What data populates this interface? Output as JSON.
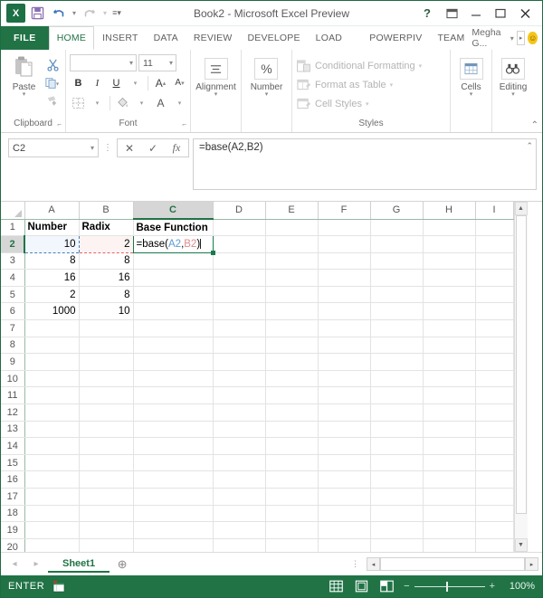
{
  "window": {
    "title": "Book2 - Microsoft Excel Preview",
    "app_icon": "excel-logo-icon",
    "quick_access": [
      {
        "name": "save-icon",
        "glyph": "💾"
      },
      {
        "name": "undo-icon",
        "glyph": "↶"
      },
      {
        "name": "redo-icon",
        "glyph": "↷"
      },
      {
        "name": "customize-qat-icon",
        "glyph": "⌄"
      }
    ],
    "controls": {
      "help": "?",
      "ribbon_display": "❐",
      "minimize": "─",
      "maximize": "☐",
      "close": "✕"
    }
  },
  "tabs": {
    "file": "FILE",
    "items": [
      "HOME",
      "INSERT",
      "DATA",
      "REVIEW",
      "DEVELOPE",
      "LOAD TES",
      "POWERPIV",
      "TEAM"
    ],
    "active": "HOME",
    "user": "Megha G...",
    "user_caret": "▾",
    "signin_arrow": "▸",
    "smiley": "☺"
  },
  "ribbon": {
    "groups": [
      {
        "name": "clipboard",
        "label": "Clipboard",
        "paste_label": "Paste",
        "paste_caret": "▾",
        "side_items": [
          {
            "name": "cut-icon",
            "label": "Cut"
          },
          {
            "name": "copy-icon",
            "label": "Copy"
          },
          {
            "name": "format-painter-icon",
            "label": "Format Painter"
          }
        ],
        "launcher": "⤵"
      },
      {
        "name": "font",
        "label": "Font",
        "font_name": "",
        "font_size": "11",
        "buttons": [
          "B",
          "I",
          "U",
          "▾",
          "A",
          "A",
          "▦",
          "▾",
          "✐",
          "▾",
          "A",
          "▾"
        ],
        "launcher": "⤵"
      },
      {
        "name": "alignment",
        "label": "Alignment",
        "icon": "align-icon",
        "caret": "▾"
      },
      {
        "name": "number",
        "label": "Number",
        "icon": "percent-icon",
        "glyph": "%",
        "caret": "▾"
      },
      {
        "name": "styles",
        "label": "Styles",
        "items": [
          {
            "name": "conditional-formatting",
            "label": "Conditional Formatting",
            "caret": "▾"
          },
          {
            "name": "format-as-table",
            "label": "Format as Table",
            "caret": "▾"
          },
          {
            "name": "cell-styles",
            "label": "Cell Styles",
            "caret": "▾"
          }
        ]
      },
      {
        "name": "cells",
        "label": "Cells",
        "icon": "cells-icon",
        "caret": "▾"
      },
      {
        "name": "editing",
        "label": "Editing",
        "icon": "binoculars-icon",
        "caret": "▾"
      }
    ],
    "collapse": "⌃"
  },
  "formula_bar": {
    "name_box": "C2",
    "name_box_caret": "▾",
    "dots": "⋮",
    "cancel": "✕",
    "enter": "✓",
    "insert_function": "fx",
    "formula": "=base(A2,B2)",
    "expand": "⌃"
  },
  "grid": {
    "columns": [
      "A",
      "B",
      "C",
      "D",
      "E",
      "F",
      "G",
      "H",
      "I"
    ],
    "selected_column": "C",
    "selected_row": 2,
    "rows": [
      1,
      2,
      3,
      4,
      5,
      6,
      7,
      8,
      9,
      10,
      11,
      12,
      13,
      14,
      15,
      16,
      17,
      18,
      19,
      20
    ],
    "headers": {
      "A": "Number",
      "B": "Radix",
      "C": "Base Function"
    },
    "data": [
      {
        "row": 2,
        "A": "10",
        "B": "2"
      },
      {
        "row": 3,
        "A": "8",
        "B": "8"
      },
      {
        "row": 4,
        "A": "16",
        "B": "16"
      },
      {
        "row": 5,
        "A": "2",
        "B": "8"
      },
      {
        "row": 6,
        "A": "1000",
        "B": "10"
      }
    ],
    "editing_cell": {
      "ref": "C2",
      "prefix": "=base(",
      "ref_a": "A2",
      "comma": ",",
      "ref_b": "B2",
      "suffix": ")"
    },
    "scroll": {
      "up": "▲",
      "down": "▼"
    }
  },
  "sheet_bar": {
    "prev": "◂",
    "next": "▸",
    "sheets": [
      "Sheet1"
    ],
    "active_sheet": "Sheet1",
    "add": "⊕",
    "dots": "⋮",
    "hscroll_left": "◂",
    "hscroll_right": "▸"
  },
  "status_bar": {
    "mode": "ENTER",
    "macro_icon": "record-macro-icon",
    "views": [
      {
        "name": "normal-view-icon",
        "label": "Normal"
      },
      {
        "name": "page-layout-view-icon",
        "label": "Page Layout"
      },
      {
        "name": "page-break-view-icon",
        "label": "Page Break Preview"
      }
    ],
    "zoom_out": "−",
    "zoom_in": "+",
    "zoom_level": "100%"
  },
  "colors": {
    "excel_green": "#217346",
    "dark_green": "#1e6b42",
    "ref_a_blue": "#5b9bd5",
    "ref_b_red": "#e08a8a",
    "selection_green": "#1a7a4c"
  }
}
